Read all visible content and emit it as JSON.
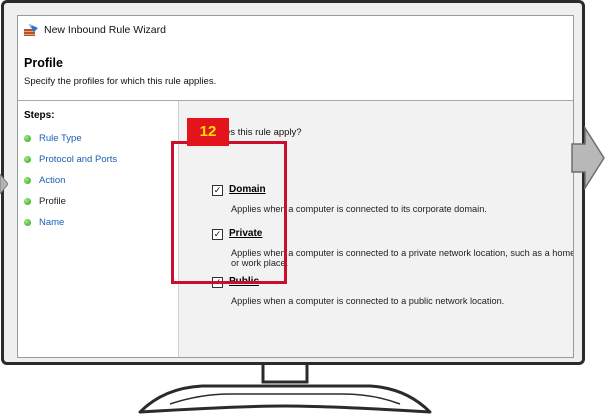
{
  "window": {
    "title": "New Inbound Rule Wizard"
  },
  "header": {
    "title": "Profile",
    "subtitle": "Specify the profiles for which this rule applies."
  },
  "steps": {
    "heading": "Steps:",
    "items": [
      {
        "label": "Rule Type",
        "state": "link"
      },
      {
        "label": "Protocol and Ports",
        "state": "link"
      },
      {
        "label": "Action",
        "state": "link"
      },
      {
        "label": "Profile",
        "state": "current"
      },
      {
        "label": "Name",
        "state": "link"
      }
    ]
  },
  "main": {
    "question": "When does this rule apply?",
    "profiles": [
      {
        "label": "Domain",
        "checked": true,
        "description": [
          "Applies when a computer is connected to its corporate domain."
        ]
      },
      {
        "label": "Private",
        "checked": true,
        "description": [
          "Applies when a computer is connected to a private network location, such as a home",
          "or work place."
        ]
      },
      {
        "label": "Public",
        "checked": true,
        "description": [
          "Applies when a computer is connected to a public network location."
        ]
      }
    ]
  },
  "annotation": {
    "badge": "12",
    "badge_color": "#e4141c",
    "badge_text_color": "#ffe000",
    "highlight_color": "#c8102e"
  },
  "colors": {
    "step_dot": "#3fb02a",
    "link": "#1a5fb4",
    "panel_bg": "#f2f2f2"
  }
}
